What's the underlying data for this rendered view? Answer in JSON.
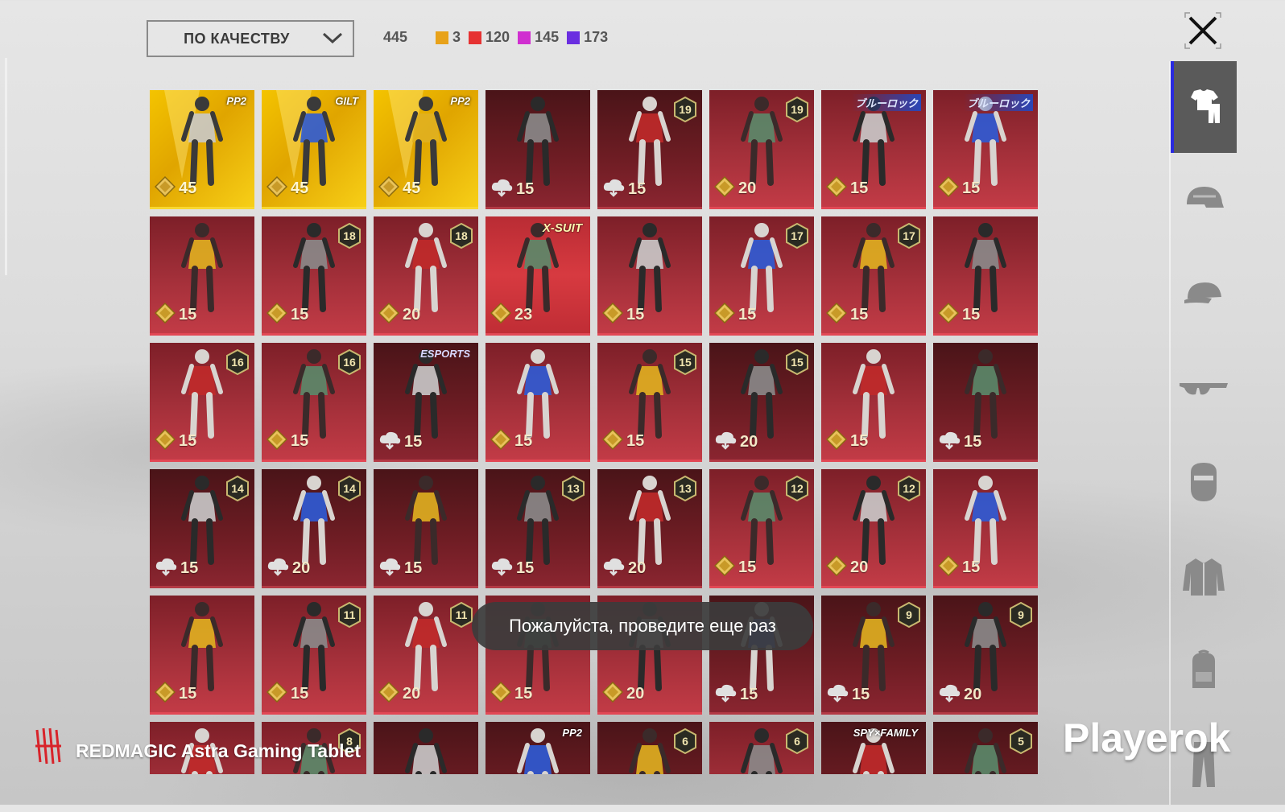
{
  "toolbar": {
    "sort_label": "ПО КАЧЕСТВУ",
    "total_count": "445",
    "rarity_counts": [
      {
        "color": "#e8a21a",
        "count": "3"
      },
      {
        "color": "#e63232",
        "count": "120"
      },
      {
        "color": "#d02fd0",
        "count": "145"
      },
      {
        "color": "#6a2ee0",
        "count": "173"
      }
    ]
  },
  "grid": {
    "items": [
      {
        "tier": "gold",
        "cost": "45",
        "currency": "coin",
        "tag": "PP2",
        "tag_style": "ppl"
      },
      {
        "tier": "gold",
        "cost": "45",
        "currency": "coin",
        "tag": "GILT",
        "tag_style": "ppl"
      },
      {
        "tier": "gold",
        "cost": "45",
        "currency": "coin",
        "tag": "PP2",
        "tag_style": "ppl"
      },
      {
        "tier": "dark",
        "cost": "15",
        "currency": "cloud"
      },
      {
        "tier": "dark",
        "cost": "15",
        "currency": "cloud",
        "level": "19"
      },
      {
        "tier": "red",
        "cost": "20",
        "currency": "coin",
        "level": "19"
      },
      {
        "tier": "red",
        "cost": "15",
        "currency": "coin",
        "tag": "ブルーロック",
        "tag_style": "blue"
      },
      {
        "tier": "red",
        "cost": "15",
        "currency": "coin",
        "tag": "ブルーロック",
        "tag_style": "blue"
      },
      {
        "tier": "red",
        "cost": "15",
        "currency": "coin"
      },
      {
        "tier": "red",
        "cost": "15",
        "currency": "coin",
        "level": "18"
      },
      {
        "tier": "red",
        "cost": "20",
        "currency": "coin",
        "level": "18"
      },
      {
        "tier": "xsuit",
        "cost": "23",
        "currency": "coin",
        "tag": "X-SUIT",
        "tag_style": "xs"
      },
      {
        "tier": "red",
        "cost": "15",
        "currency": "coin"
      },
      {
        "tier": "red",
        "cost": "15",
        "currency": "coin",
        "level": "17"
      },
      {
        "tier": "red",
        "cost": "15",
        "currency": "coin",
        "level": "17"
      },
      {
        "tier": "red",
        "cost": "15",
        "currency": "coin"
      },
      {
        "tier": "red",
        "cost": "15",
        "currency": "coin",
        "level": "16"
      },
      {
        "tier": "red",
        "cost": "15",
        "currency": "coin",
        "level": "16"
      },
      {
        "tier": "dark",
        "cost": "15",
        "currency": "cloud",
        "tag": "ESPORTS",
        "tag_style": "esp"
      },
      {
        "tier": "red",
        "cost": "15",
        "currency": "coin"
      },
      {
        "tier": "red",
        "cost": "15",
        "currency": "coin",
        "level": "15"
      },
      {
        "tier": "dark",
        "cost": "20",
        "currency": "cloud",
        "level": "15"
      },
      {
        "tier": "red",
        "cost": "15",
        "currency": "coin"
      },
      {
        "tier": "dark",
        "cost": "15",
        "currency": "cloud"
      },
      {
        "tier": "dark",
        "cost": "15",
        "currency": "cloud",
        "level": "14"
      },
      {
        "tier": "dark",
        "cost": "20",
        "currency": "cloud",
        "level": "14"
      },
      {
        "tier": "dark",
        "cost": "15",
        "currency": "cloud"
      },
      {
        "tier": "dark",
        "cost": "15",
        "currency": "cloud",
        "level": "13"
      },
      {
        "tier": "dark",
        "cost": "20",
        "currency": "cloud",
        "level": "13"
      },
      {
        "tier": "red",
        "cost": "15",
        "currency": "coin",
        "level": "12"
      },
      {
        "tier": "red",
        "cost": "20",
        "currency": "coin",
        "level": "12"
      },
      {
        "tier": "red",
        "cost": "15",
        "currency": "coin"
      },
      {
        "tier": "red",
        "cost": "15",
        "currency": "coin"
      },
      {
        "tier": "red",
        "cost": "15",
        "currency": "coin",
        "level": "11"
      },
      {
        "tier": "red",
        "cost": "20",
        "currency": "coin",
        "level": "11"
      },
      {
        "tier": "red",
        "cost": "15",
        "currency": "coin"
      },
      {
        "tier": "red",
        "cost": "20",
        "currency": "coin"
      },
      {
        "tier": "dark",
        "cost": "15",
        "currency": "cloud"
      },
      {
        "tier": "dark",
        "cost": "15",
        "currency": "cloud",
        "level": "9"
      },
      {
        "tier": "dark",
        "cost": "20",
        "currency": "cloud",
        "level": "9"
      },
      {
        "tier": "red",
        "cost": "",
        "currency": ""
      },
      {
        "tier": "red",
        "cost": "",
        "currency": "",
        "level": "8"
      },
      {
        "tier": "dark",
        "cost": "",
        "currency": ""
      },
      {
        "tier": "dark",
        "cost": "",
        "currency": "",
        "tag": "PP2",
        "tag_style": "ppl"
      },
      {
        "tier": "dark",
        "cost": "",
        "currency": "",
        "level": "6"
      },
      {
        "tier": "red",
        "cost": "",
        "currency": "",
        "level": "6"
      },
      {
        "tier": "dark",
        "cost": "",
        "currency": "",
        "tag": "SPY×FAMILY",
        "tag_style": "ppl"
      },
      {
        "tier": "dark",
        "cost": "",
        "currency": "",
        "level": "5"
      }
    ]
  },
  "sidebar": {
    "items": [
      {
        "name": "outfit",
        "icon": "outfit-icon",
        "active": true
      },
      {
        "name": "helmet",
        "icon": "helmet-icon",
        "active": false
      },
      {
        "name": "cap",
        "icon": "cap-icon",
        "active": false
      },
      {
        "name": "glasses",
        "icon": "glasses-icon",
        "active": false
      },
      {
        "name": "mask",
        "icon": "mask-icon",
        "active": false
      },
      {
        "name": "jacket",
        "icon": "jacket-icon",
        "active": false
      },
      {
        "name": "backpack",
        "icon": "backpack-icon",
        "active": false
      },
      {
        "name": "pants",
        "icon": "pants-icon",
        "active": false
      }
    ]
  },
  "toast": {
    "message": "Пожалуйста, проведите еще раз"
  },
  "watermarks": {
    "device": "REDMAGIC Astra Gaming Tablet",
    "site": "Playerok"
  }
}
